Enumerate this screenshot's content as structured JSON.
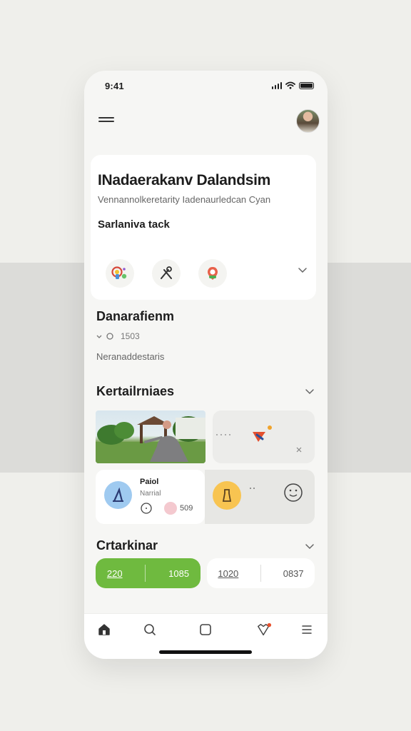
{
  "status_bar": {
    "time": "9:41"
  },
  "header": {
    "menu_icon": "hamburger-icon",
    "avatar_icon": "profile-avatar"
  },
  "hero_card": {
    "title": "INadaerakanv Dalandsim",
    "subtitle": "Vennannolkeretarity Iadenaurledcan Cyan",
    "section_label": "Sarlaniva tack",
    "icons": [
      "colorful-badge-icon",
      "crossed-tools-icon",
      "pin-badge-icon"
    ]
  },
  "section_info": {
    "title": "Danarafienm",
    "meta_value": "1503",
    "note": "Neranaddestaris"
  },
  "section_media": {
    "title": "Kertailrniaes",
    "profile_tile": {
      "name": "Paiol",
      "role": "Narrial",
      "count": "509"
    },
    "icons": [
      "sparkle-arrow-icon",
      "torch-icon",
      "smiley-icon"
    ]
  },
  "section_actions": {
    "title": "Crtarkinar",
    "green_values": [
      "220",
      "1085"
    ],
    "white_values": [
      "1020",
      "0837"
    ]
  },
  "tab_bar": {
    "items": [
      "home-icon",
      "search-icon",
      "square-icon",
      "heart-icon",
      "menu-lines-icon"
    ],
    "accent": "#6fba3f",
    "badge_color": "#e84f2c"
  }
}
